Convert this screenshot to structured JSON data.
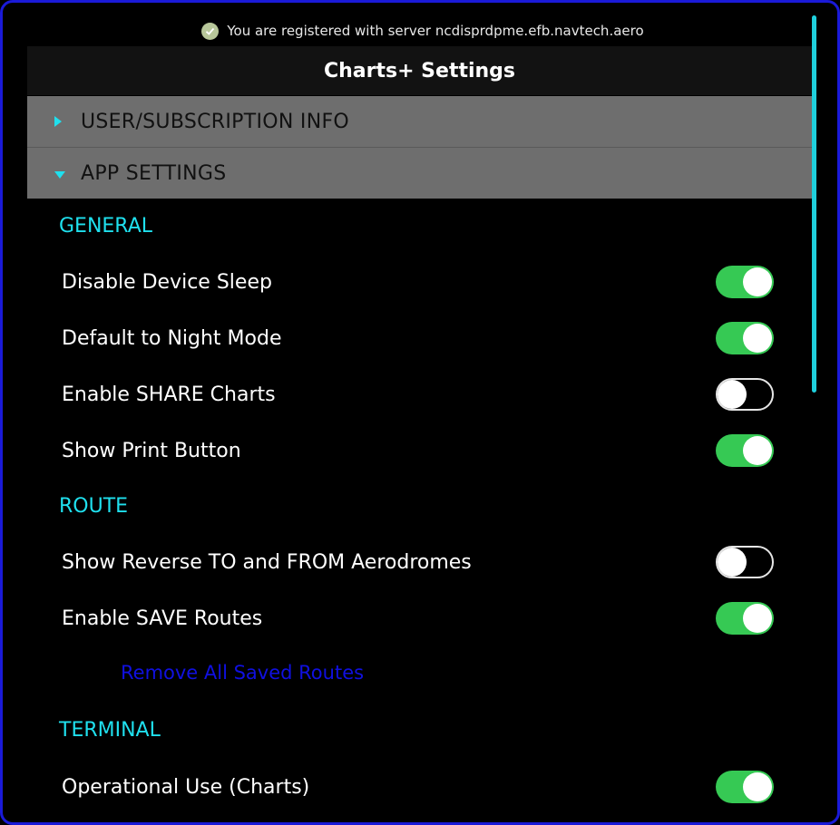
{
  "registration": {
    "message": "You are registered with server ncdisprdpme.efb.navtech.aero",
    "icon": "check-circle-icon"
  },
  "header": {
    "title": "Charts+ Settings"
  },
  "sections": {
    "user": {
      "label": "USER/SUBSCRIPTION INFO",
      "expanded": false
    },
    "app": {
      "label": "APP SETTINGS",
      "expanded": true
    }
  },
  "general": {
    "title": "GENERAL",
    "items": [
      {
        "label": "Disable Device Sleep",
        "on": true
      },
      {
        "label": "Default to Night Mode",
        "on": true
      },
      {
        "label": "Enable SHARE Charts",
        "on": false
      },
      {
        "label": "Show Print Button",
        "on": true
      }
    ]
  },
  "route": {
    "title": "ROUTE",
    "items": [
      {
        "label": "Show Reverse TO and FROM Aerodromes",
        "on": false
      },
      {
        "label": "Enable SAVE Routes",
        "on": true
      }
    ],
    "remove_link": "Remove All Saved Routes"
  },
  "terminal": {
    "title": "TERMINAL",
    "items": [
      {
        "label": "Operational Use (Charts)",
        "on": true
      }
    ]
  },
  "colors": {
    "accent": "#1fe0ee",
    "toggle_on": "#36c954",
    "link": "#1010e0",
    "border": "#1a1ad8"
  }
}
